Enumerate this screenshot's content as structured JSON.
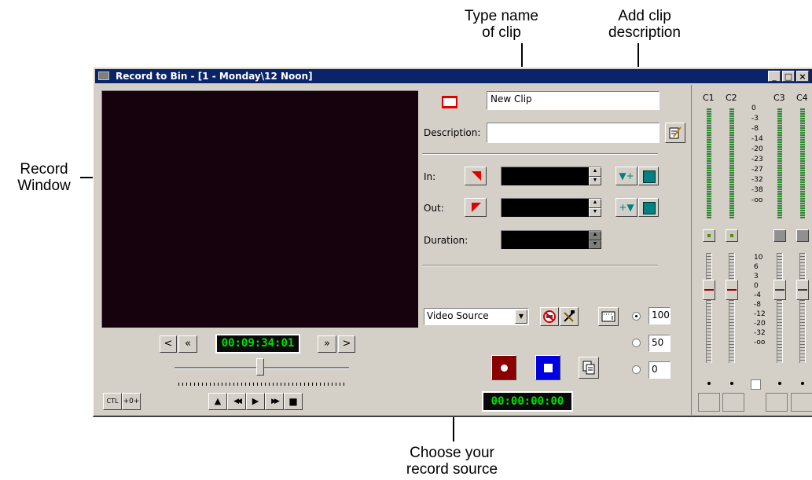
{
  "callouts": {
    "type_name": "Type name\nof clip",
    "add_desc": "Add clip\ndescription",
    "record_window": "Record\nWindow",
    "choose_source": "Choose your\nrecord source"
  },
  "window": {
    "title": "Record to Bin - [1 - Monday\\12 Noon]",
    "min_btn": "_",
    "max_btn": "□",
    "close_btn": "×"
  },
  "clip": {
    "name_value": "New Clip",
    "description_label": "Description:",
    "description_value": ""
  },
  "marks": {
    "in_label": "In:",
    "out_label": "Out:",
    "duration_label": "Duration:"
  },
  "transport": {
    "timecode": "00:09:34:01",
    "prev_frame": "<",
    "rewind": "«",
    "forward": "»",
    "next_frame": ">",
    "ctl_label": "CTL",
    "offset_label": "+0+",
    "eject": "▲",
    "rew": "◀◀",
    "play": "▶",
    "ffwd": "▶▶",
    "stop": "■"
  },
  "source": {
    "selected": "Video Source"
  },
  "record": {
    "timecode": "00:00:00:00"
  },
  "rate": {
    "options": [
      "100",
      "50",
      "0"
    ],
    "selected_index": 0
  },
  "mixer": {
    "channels": [
      "C1",
      "C2",
      "C3",
      "C4"
    ],
    "scale_top": [
      "0",
      "-3",
      "-8",
      "-14",
      "-20",
      "-23",
      "-27",
      "-32",
      "-38",
      "-oo"
    ],
    "scale_bottom": [
      "10",
      "6",
      "3",
      "0",
      "-4",
      "-8",
      "-12",
      "-20",
      "-32",
      "-oo"
    ]
  }
}
